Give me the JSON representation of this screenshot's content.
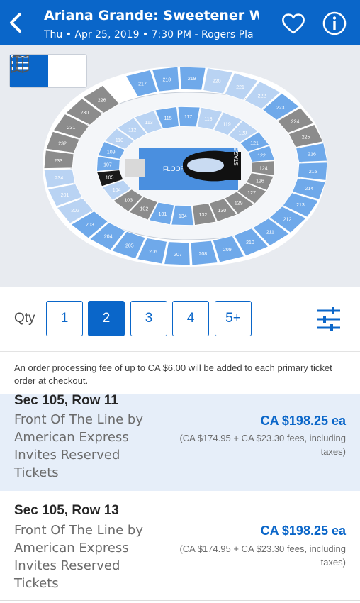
{
  "header": {
    "title": "Ariana Grande: Sweetener W",
    "subtitle": "Thu • Apr 25, 2019 • 7:30 PM - Rogers Pla"
  },
  "map": {
    "floor_label": "FLOOR",
    "stage_label": "STAGE",
    "upper": [
      "217",
      "218",
      "219",
      "220",
      "221",
      "222",
      "223",
      "224",
      "225",
      "216",
      "215",
      "214",
      "213",
      "212",
      "211",
      "210",
      "209",
      "208",
      "207",
      "206",
      "205",
      "204",
      "203",
      "202",
      "201",
      "234",
      "233",
      "232",
      "231",
      "230",
      "226"
    ],
    "lower": [
      "115",
      "117",
      "118",
      "119",
      "120",
      "121",
      "122",
      "124",
      "126",
      "127",
      "129",
      "130",
      "132",
      "134",
      "101",
      "102",
      "103",
      "104",
      "105",
      "107",
      "109",
      "110",
      "112",
      "113"
    ],
    "colors": {
      "available": "#6fa9ea",
      "light": "#b9d3f3",
      "unavailable": "#8c8c8c",
      "selected": "#1a1a1a",
      "floor": "#4a8fdf"
    }
  },
  "quantity": {
    "label": "Qty",
    "options": [
      "1",
      "2",
      "3",
      "4",
      "5+"
    ],
    "selected": "2"
  },
  "notice": "An order processing fee of up to CA $6.00 will be added to each primary ticket order at checkout.",
  "listings": [
    {
      "section": "Sec 105, Row 11",
      "description": "Front Of The Line by American Express Invites Reserved Tickets",
      "price": "CA $198.25 ea",
      "fees": "(CA $174.95 + CA $23.30 fees, including taxes)"
    },
    {
      "section": "Sec 105, Row 13",
      "description": "Front Of The Line by American Express Invites Reserved Tickets",
      "price": "CA $198.25 ea",
      "fees": "(CA $174.95 + CA $23.30 fees, including taxes)"
    }
  ]
}
